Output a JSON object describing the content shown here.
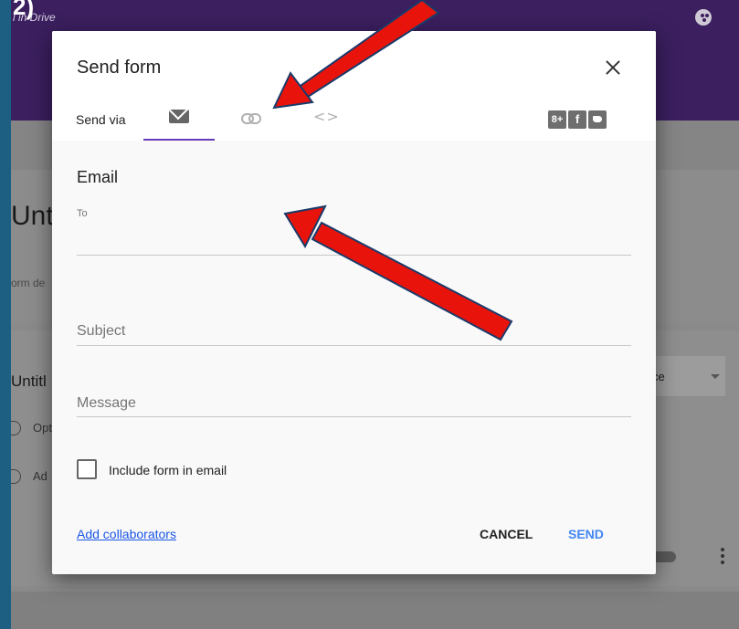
{
  "background_app": {
    "saved_text": "l in Drive",
    "form_title": "Unt",
    "form_description": "orm de",
    "question_title": "Untitl",
    "question_type": "ce",
    "options": [
      "Opt",
      "Ad"
    ],
    "header_color": "#3b1f5f",
    "corner_glyph": "2)"
  },
  "dialog": {
    "title": "Send form",
    "send_via_label": "Send via",
    "tabs": [
      {
        "name": "email",
        "icon": "mail-icon",
        "active": true
      },
      {
        "name": "link",
        "icon": "link-icon",
        "active": false
      },
      {
        "name": "embed",
        "icon": "embed-icon",
        "glyph": "<>",
        "active": false
      }
    ],
    "social": [
      {
        "icon": "google-plus-icon",
        "glyph": "8+"
      },
      {
        "icon": "facebook-icon",
        "glyph": "f"
      },
      {
        "icon": "twitter-icon",
        "glyph": ""
      }
    ],
    "section_title": "Email",
    "to_label": "To",
    "to_value": "",
    "subject_label": "Subject",
    "message_label": "Message",
    "include_form_label": "Include form in email",
    "include_form_checked": false,
    "add_collaborators_label": "Add collaborators",
    "cancel_label": "CANCEL",
    "send_label": "SEND",
    "accent_color": "#673ab7",
    "link_color": "#1a55e6",
    "send_color": "#4285f4"
  },
  "annotations": {
    "arrow_color": "#e8140c",
    "arrows": [
      "arrow-pointing-to-link-tab",
      "arrow-pointing-to-to-field"
    ]
  }
}
